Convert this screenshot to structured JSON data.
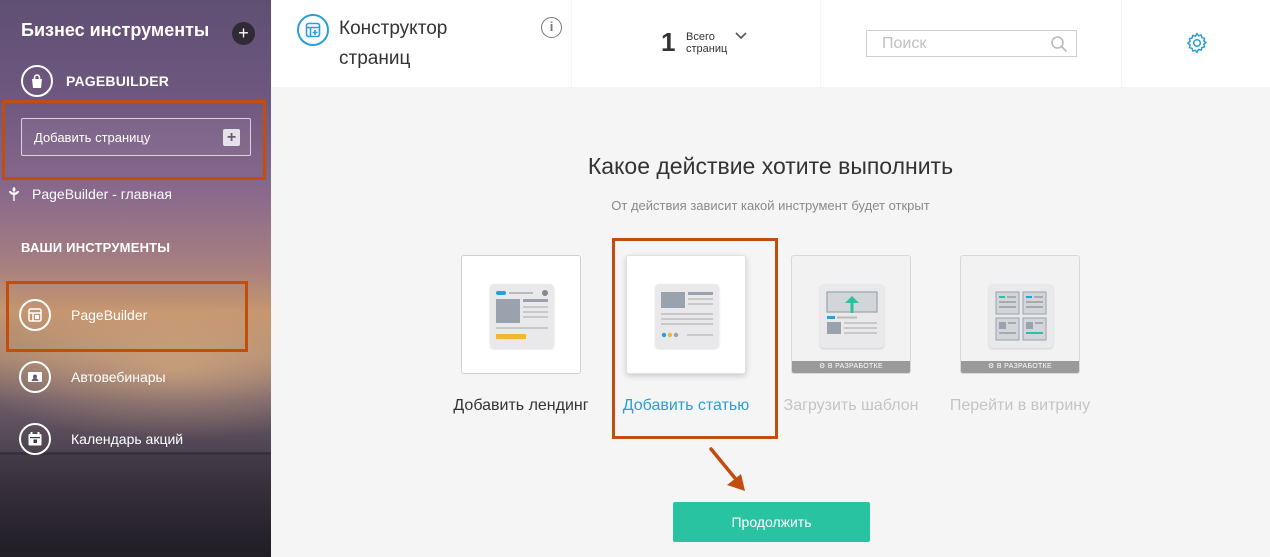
{
  "sidebar": {
    "title": "Бизнес инструменты",
    "add_icon": "plus-icon",
    "pagebuilder_header": "PAGEBUILDER",
    "add_page_label": "Добавить страницу",
    "home_page_label": "PageBuilder - главная",
    "tools_title": "ВАШИ ИНСТРУМЕНТЫ",
    "tools": [
      {
        "label": "PageBuilder",
        "icon": "page-layout-icon"
      },
      {
        "label": "Автовебинары",
        "icon": "webinar-icon"
      },
      {
        "label": "Календарь акций",
        "icon": "calendar-icon"
      }
    ]
  },
  "header": {
    "title": "Конструктор страниц",
    "info": "i",
    "pages_count": "1",
    "pages_label": "Всего страниц",
    "search_placeholder": "Поиск"
  },
  "main": {
    "heading": "Какое действие хотите выполнить",
    "subheading": "От действия зависит какой инструмент будет открыт",
    "badge": "⚙ В РАЗРАБОТКЕ",
    "options": [
      {
        "label": "Добавить лендинг",
        "state": "available"
      },
      {
        "label": "Добавить статью",
        "state": "selected"
      },
      {
        "label": "Загрузить шаблон",
        "state": "in-development"
      },
      {
        "label": "Перейти в витрину",
        "state": "in-development"
      }
    ],
    "continue_label": "Продолжить"
  },
  "colors": {
    "accent_teal": "#28c4a2",
    "link_blue": "#2a9fd8",
    "highlight_orange": "#c14d0e"
  }
}
